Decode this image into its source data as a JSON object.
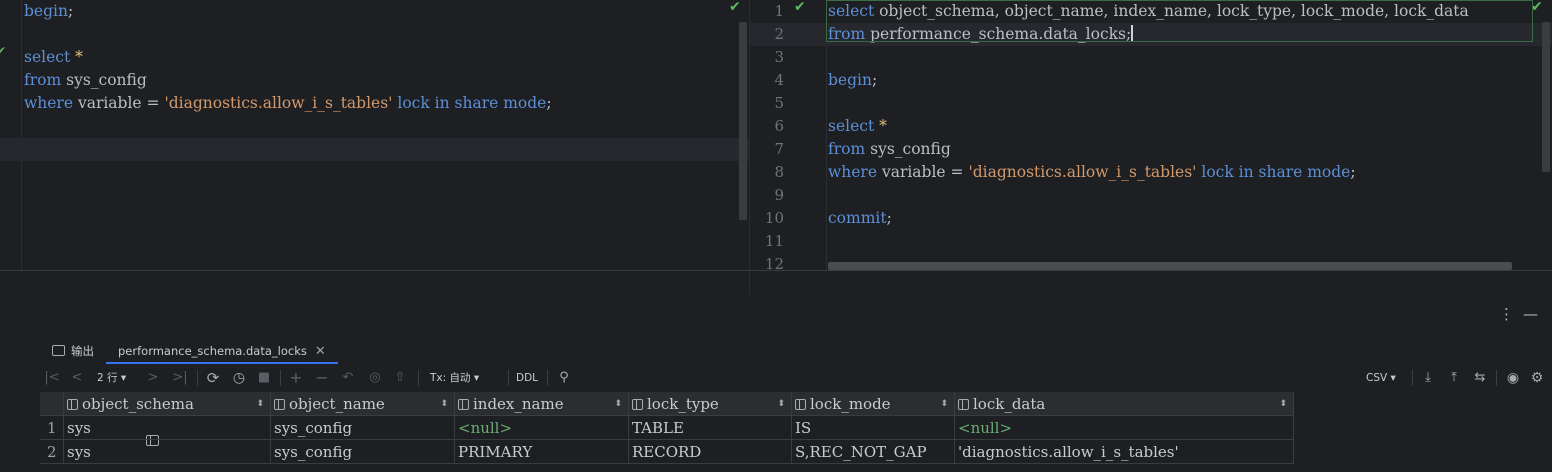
{
  "editor_left": {
    "lines": [
      [
        {
          "t": "begin",
          "c": "kw"
        },
        {
          "t": ";",
          "c": "plain"
        }
      ],
      [],
      [
        {
          "t": "select",
          "c": "kw"
        },
        {
          "t": " ",
          "c": "plain"
        },
        {
          "t": "*",
          "c": "star"
        }
      ],
      [
        {
          "t": "from",
          "c": "kw"
        },
        {
          "t": " sys_config",
          "c": "plain"
        }
      ],
      [
        {
          "t": "where",
          "c": "kw"
        },
        {
          "t": " variable = ",
          "c": "plain"
        },
        {
          "t": "'diagnostics.allow_i_s_tables'",
          "c": "str"
        },
        {
          "t": " ",
          "c": "plain"
        },
        {
          "t": "lock in share mode",
          "c": "kw"
        },
        {
          "t": ";",
          "c": "plain"
        }
      ],
      [],
      []
    ]
  },
  "editor_right": {
    "line_numbers": [
      "1",
      "2",
      "3",
      "4",
      "5",
      "6",
      "7",
      "8",
      "9",
      "10",
      "11",
      "12"
    ],
    "lines": [
      [
        {
          "t": "select",
          "c": "kw"
        },
        {
          "t": " object_schema, object_name, index_name, lock_type, lock_mode, lock_data",
          "c": "plain"
        }
      ],
      [
        {
          "t": "from",
          "c": "kw"
        },
        {
          "t": " performance_schema.data_locks;",
          "c": "plain"
        }
      ],
      [],
      [
        {
          "t": "begin",
          "c": "kw"
        },
        {
          "t": ";",
          "c": "plain"
        }
      ],
      [],
      [
        {
          "t": "select",
          "c": "kw"
        },
        {
          "t": " ",
          "c": "plain"
        },
        {
          "t": "*",
          "c": "star"
        }
      ],
      [
        {
          "t": "from",
          "c": "kw"
        },
        {
          "t": " sys_config",
          "c": "plain"
        }
      ],
      [
        {
          "t": "where",
          "c": "kw"
        },
        {
          "t": " variable = ",
          "c": "plain"
        },
        {
          "t": "'diagnostics.allow_i_s_tables'",
          "c": "str"
        },
        {
          "t": " ",
          "c": "plain"
        },
        {
          "t": "lock in share mode",
          "c": "kw"
        },
        {
          "t": ";",
          "c": "plain"
        }
      ],
      [],
      [
        {
          "t": "commit",
          "c": "kw"
        },
        {
          "t": ";",
          "c": "plain"
        }
      ],
      [],
      []
    ]
  },
  "colors": {
    "keyword": "#5c8fd6",
    "string": "#d29a6b",
    "check": "#5fb865",
    "null": "#6aab73",
    "accent": "#3574f0"
  },
  "panel": {
    "menu_icon": "⋮",
    "minimize_icon": "—",
    "tabs": [
      {
        "label": "输出",
        "icon": "console-icon"
      },
      {
        "label": "performance_schema.data_locks",
        "icon": "table-icon",
        "close": "✕"
      }
    ],
    "toolbar": {
      "rows_label": "2 行",
      "tx_label": "Tx: 自动",
      "ddl_label": "DDL",
      "export_format": "CSV"
    },
    "grid": {
      "columns": [
        "object_schema",
        "object_name",
        "index_name",
        "lock_type",
        "lock_mode",
        "lock_data"
      ],
      "rows": [
        {
          "num": "1",
          "cells": [
            "sys",
            "sys_config",
            "<null>",
            "TABLE",
            "IS",
            "<null>"
          ]
        },
        {
          "num": "2",
          "cells": [
            "sys",
            "sys_config",
            "PRIMARY",
            "RECORD",
            "S,REC_NOT_GAP",
            "'diagnostics.allow_i_s_tables'"
          ]
        }
      ]
    }
  }
}
